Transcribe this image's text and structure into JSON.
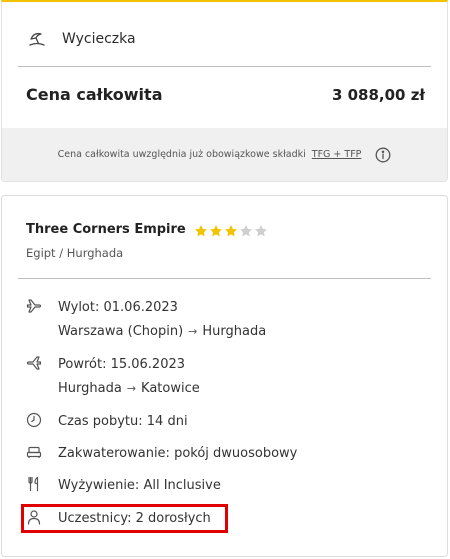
{
  "summary": {
    "trip_label": "Wycieczka",
    "total_label": "Cena całkowita",
    "total_value": "3 088,00 zł",
    "note_text": "Cena całkowita uwzględnia już obowiązkowe składki",
    "note_link": "TFG + TFP"
  },
  "hotel": {
    "name": "Three Corners Empire",
    "stars_filled": 3,
    "stars_total": 5,
    "location": "Egipt / Hurghada"
  },
  "details": {
    "departure": {
      "label": "Wylot: 01.06.2023",
      "from": "Warszawa (Chopin)",
      "to": "Hurghada"
    },
    "return": {
      "label": "Powrót: 15.06.2023",
      "from": "Hurghada",
      "to": "Katowice"
    },
    "duration": "Czas pobytu: 14 dni",
    "accommodation": "Zakwaterowanie: pokój dwuosobowy",
    "board": "Wyżywienie: All Inclusive",
    "participants": "Uczestnicy: 2 dorosłych"
  },
  "colors": {
    "accent_yellow": "#f4c300",
    "star_filled": "#f4c300",
    "star_empty": "#cfcfcf",
    "highlight": "#e10000"
  }
}
